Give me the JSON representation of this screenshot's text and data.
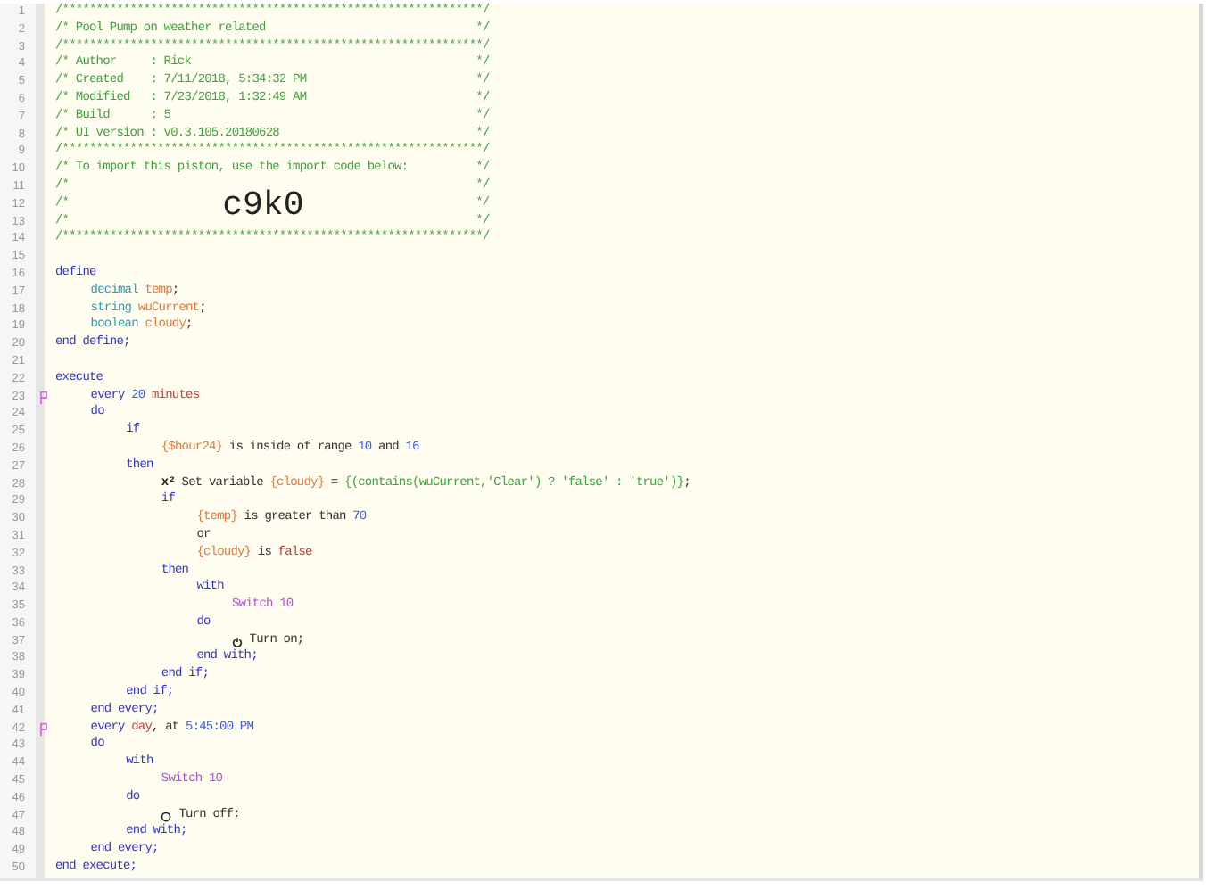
{
  "lines": [
    {
      "number": "1",
      "flagged": false,
      "tokens": [
        {
          "text": "/**************************************************************/",
          "kind": "comment"
        }
      ]
    },
    {
      "number": "2",
      "flagged": false,
      "tokens": [
        {
          "text": "/* Pool Pump on weather related                               */",
          "kind": "comment"
        }
      ]
    },
    {
      "number": "3",
      "flagged": false,
      "tokens": [
        {
          "text": "/**************************************************************/",
          "kind": "comment"
        }
      ]
    },
    {
      "number": "4",
      "flagged": false,
      "tokens": [
        {
          "text": "/* Author     : Rick                                          */",
          "kind": "comment"
        }
      ]
    },
    {
      "number": "5",
      "flagged": false,
      "tokens": [
        {
          "text": "/* Created    : 7/11/2018, 5:34:32 PM                         */",
          "kind": "comment"
        }
      ]
    },
    {
      "number": "6",
      "flagged": false,
      "tokens": [
        {
          "text": "/* Modified   : 7/23/2018, 1:32:49 AM                         */",
          "kind": "comment"
        }
      ]
    },
    {
      "number": "7",
      "flagged": false,
      "tokens": [
        {
          "text": "/* Build      : 5                                             */",
          "kind": "comment"
        }
      ]
    },
    {
      "number": "8",
      "flagged": false,
      "tokens": [
        {
          "text": "/* UI version : v0.3.105.20180628                             */",
          "kind": "comment"
        }
      ]
    },
    {
      "number": "9",
      "flagged": false,
      "tokens": [
        {
          "text": "/**************************************************************/",
          "kind": "comment"
        }
      ]
    },
    {
      "number": "10",
      "flagged": false,
      "tokens": [
        {
          "text": "/* To import this piston, use the import code below:          */",
          "kind": "comment"
        }
      ]
    },
    {
      "number": "11",
      "flagged": false,
      "tokens": [
        {
          "text": "/*                                                            */",
          "kind": "comment"
        }
      ]
    },
    {
      "number": "12",
      "flagged": false,
      "tokens": [
        {
          "text": "/*",
          "kind": "comment"
        },
        {
          "text": "c9k0",
          "kind": "import-code"
        },
        {
          "text": "*/",
          "kind": "comment"
        }
      ]
    },
    {
      "number": "13",
      "flagged": false,
      "tokens": [
        {
          "text": "/*                                                            */",
          "kind": "comment"
        }
      ]
    },
    {
      "number": "14",
      "flagged": false,
      "tokens": [
        {
          "text": "/**************************************************************/",
          "kind": "comment"
        }
      ]
    },
    {
      "number": "15",
      "flagged": false
    },
    {
      "number": "16",
      "flagged": false,
      "tokens": [
        {
          "text": "define",
          "kind": "keyword"
        }
      ],
      "children": [
        {
          "number": "17",
          "flagged": false,
          "tokens": [
            {
              "text": "decimal ",
              "kind": "type"
            },
            {
              "text": "temp",
              "kind": "variable"
            },
            {
              "text": ";",
              "kind": "plain"
            }
          ]
        },
        {
          "number": "18",
          "flagged": false,
          "tokens": [
            {
              "text": "string ",
              "kind": "type"
            },
            {
              "text": "wuCurrent",
              "kind": "variable"
            },
            {
              "text": ";",
              "kind": "plain"
            }
          ]
        },
        {
          "number": "19",
          "flagged": false,
          "tokens": [
            {
              "text": "boolean ",
              "kind": "type"
            },
            {
              "text": "cloudy",
              "kind": "variable"
            },
            {
              "text": ";",
              "kind": "plain"
            }
          ]
        }
      ]
    },
    {
      "number": "20",
      "flagged": false,
      "tokens": [
        {
          "text": "end define;",
          "kind": "keyword"
        }
      ]
    },
    {
      "number": "21",
      "flagged": false
    },
    {
      "number": "22",
      "flagged": false,
      "tokens": [
        {
          "text": "execute",
          "kind": "keyword"
        }
      ],
      "children": [
        {
          "number": "23",
          "flagged": true,
          "tokens": [
            {
              "text": "every ",
              "kind": "keyword"
            },
            {
              "text": "20",
              "kind": "number"
            },
            {
              "text": " minutes",
              "kind": "unit"
            }
          ]
        },
        {
          "number": "24",
          "flagged": false,
          "tokens": [
            {
              "text": "do",
              "kind": "keyword"
            }
          ],
          "children": [
            {
              "number": "25",
              "flagged": false,
              "tokens": [
                {
                  "text": "if",
                  "kind": "keyword"
                }
              ],
              "children": [
                {
                  "number": "26",
                  "flagged": false,
                  "tokens": [
                    {
                      "text": "{$hour24}",
                      "kind": "variable"
                    },
                    {
                      "text": " is inside of range ",
                      "kind": "plain"
                    },
                    {
                      "text": "10",
                      "kind": "number"
                    },
                    {
                      "text": " and ",
                      "kind": "plain"
                    },
                    {
                      "text": "16",
                      "kind": "number"
                    }
                  ]
                }
              ]
            },
            {
              "number": "27",
              "flagged": false,
              "tokens": [
                {
                  "text": "then",
                  "kind": "keyword"
                }
              ],
              "children": [
                {
                  "number": "28",
                  "flagged": false,
                  "tokens": [
                    {
                      "text": "x²",
                      "kind": "symbol"
                    },
                    {
                      "text": " Set variable ",
                      "kind": "plain"
                    },
                    {
                      "text": "{cloudy}",
                      "kind": "variable"
                    },
                    {
                      "text": " = ",
                      "kind": "plain"
                    },
                    {
                      "text": "{(contains(wuCurrent,'Clear') ? 'false' : 'true')}",
                      "kind": "expression"
                    },
                    {
                      "text": ";",
                      "kind": "plain"
                    }
                  ]
                },
                {
                  "number": "29",
                  "flagged": false,
                  "tokens": [
                    {
                      "text": "if",
                      "kind": "keyword"
                    }
                  ],
                  "children": [
                    {
                      "number": "30",
                      "flagged": false,
                      "tokens": [
                        {
                          "text": "{temp}",
                          "kind": "variable"
                        },
                        {
                          "text": " is greater than ",
                          "kind": "plain"
                        },
                        {
                          "text": "70",
                          "kind": "number"
                        }
                      ]
                    },
                    {
                      "number": "31",
                      "flagged": false,
                      "tokens": [
                        {
                          "text": "or",
                          "kind": "plain"
                        }
                      ]
                    },
                    {
                      "number": "32",
                      "flagged": false,
                      "tokens": [
                        {
                          "text": "{cloudy}",
                          "kind": "variable"
                        },
                        {
                          "text": " is ",
                          "kind": "plain"
                        },
                        {
                          "text": "false",
                          "kind": "unit"
                        }
                      ]
                    }
                  ]
                },
                {
                  "number": "33",
                  "flagged": false,
                  "tokens": [
                    {
                      "text": "then",
                      "kind": "keyword"
                    }
                  ],
                  "children": [
                    {
                      "number": "34",
                      "flagged": false,
                      "tokens": [
                        {
                          "text": "with",
                          "kind": "keyword"
                        }
                      ],
                      "children": [
                        {
                          "number": "35",
                          "flagged": false,
                          "tokens": [
                            {
                              "text": "Switch 10",
                              "kind": "device"
                            }
                          ]
                        }
                      ]
                    },
                    {
                      "number": "36",
                      "flagged": false,
                      "tokens": [
                        {
                          "text": "do",
                          "kind": "keyword"
                        }
                      ],
                      "children": [
                        {
                          "number": "37",
                          "flagged": false,
                          "tokens": [
                            {
                              "kind": "power-icon"
                            },
                            {
                              "text": " Turn on;",
                              "kind": "plain"
                            }
                          ]
                        }
                      ]
                    },
                    {
                      "number": "38",
                      "flagged": false,
                      "tokens": [
                        {
                          "text": "end with;",
                          "kind": "keyword"
                        }
                      ]
                    }
                  ]
                },
                {
                  "number": "39",
                  "flagged": false,
                  "tokens": [
                    {
                      "text": "end if;",
                      "kind": "keyword"
                    }
                  ]
                }
              ]
            },
            {
              "number": "40",
              "flagged": false,
              "tokens": [
                {
                  "text": "end if;",
                  "kind": "keyword"
                }
              ]
            }
          ]
        },
        {
          "number": "41",
          "flagged": false,
          "tokens": [
            {
              "text": "end every;",
              "kind": "keyword"
            }
          ]
        },
        {
          "number": "42",
          "flagged": true,
          "tokens": [
            {
              "text": "every ",
              "kind": "keyword"
            },
            {
              "text": "day",
              "kind": "unit"
            },
            {
              "text": ", at ",
              "kind": "plain"
            },
            {
              "text": "5:45:00 PM",
              "kind": "number"
            }
          ]
        },
        {
          "number": "43",
          "flagged": false,
          "tokens": [
            {
              "text": "do",
              "kind": "keyword"
            }
          ],
          "children": [
            {
              "number": "44",
              "flagged": false,
              "tokens": [
                {
                  "text": "with",
                  "kind": "keyword"
                }
              ],
              "children": [
                {
                  "number": "45",
                  "flagged": false,
                  "tokens": [
                    {
                      "text": "Switch 10",
                      "kind": "device"
                    }
                  ]
                }
              ]
            },
            {
              "number": "46",
              "flagged": false,
              "tokens": [
                {
                  "text": "do",
                  "kind": "keyword"
                }
              ],
              "children": [
                {
                  "number": "47",
                  "flagged": false,
                  "tokens": [
                    {
                      "kind": "circle-icon"
                    },
                    {
                      "text": " Turn off;",
                      "kind": "plain"
                    }
                  ]
                }
              ]
            },
            {
              "number": "48",
              "flagged": false,
              "tokens": [
                {
                  "text": "end with;",
                  "kind": "keyword"
                }
              ]
            }
          ]
        },
        {
          "number": "49",
          "flagged": false,
          "tokens": [
            {
              "text": "end every;",
              "kind": "keyword"
            }
          ]
        }
      ]
    },
    {
      "number": "50",
      "flagged": false,
      "tokens": [
        {
          "text": "end execute;",
          "kind": "keyword"
        }
      ]
    }
  ]
}
